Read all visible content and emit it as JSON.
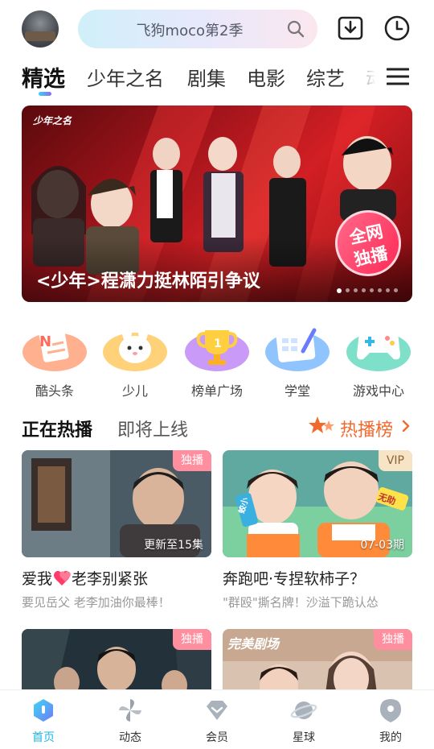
{
  "header": {
    "search_placeholder": "飞狗moco第2季",
    "icons": [
      "search-icon",
      "download-icon",
      "history-icon"
    ]
  },
  "nav": {
    "tabs": [
      {
        "label": "精选",
        "active": true
      },
      {
        "label": "少年之名"
      },
      {
        "label": "剧集"
      },
      {
        "label": "电影"
      },
      {
        "label": "综艺"
      },
      {
        "label": "动"
      }
    ]
  },
  "banner": {
    "title": "<少年>程潇力挺林陌引争议",
    "badge_line1": "全网",
    "badge_line2": "独播",
    "logo_text": "少年之名",
    "slide_count": 8,
    "active_slide": 1
  },
  "shortcuts": [
    {
      "label": "酷头条",
      "icon": "news-icon"
    },
    {
      "label": "少儿",
      "icon": "bunny-icon"
    },
    {
      "label": "榜单广场",
      "icon": "trophy-icon"
    },
    {
      "label": "学堂",
      "icon": "notebook-icon"
    },
    {
      "label": "游戏中心",
      "icon": "gamepad-icon"
    }
  ],
  "section": {
    "active_tab": "正在热播",
    "other_tab": "即将上线",
    "hot_link": "热播榜"
  },
  "cards": [
    {
      "tag": "独播",
      "note": "更新至15集",
      "title_a": "爱我",
      "title_b": "老李别紧张",
      "subtitle": "要见岳父 老李加油你最棒！"
    },
    {
      "tag": "VIP",
      "note": "07-03期",
      "title": "奔跑吧·专捏软柿子？",
      "subtitle": "\"群殴\"撕名牌！沙溢下跪认怂",
      "art_text_1": "蛟小",
      "art_text_2": "无助"
    },
    {
      "tag": "独播"
    },
    {
      "tag": "独播",
      "art_text": "完美剧场"
    }
  ],
  "bottom_nav": [
    {
      "label": "首页",
      "active": true
    },
    {
      "label": "动态"
    },
    {
      "label": "会员"
    },
    {
      "label": "星球"
    },
    {
      "label": "我的"
    }
  ],
  "colors": {
    "accent": "#1bb8e8",
    "hot": "#f06a2e",
    "tag_pink": "#ff8e9e",
    "vip_gold": "#f7e4c6"
  }
}
